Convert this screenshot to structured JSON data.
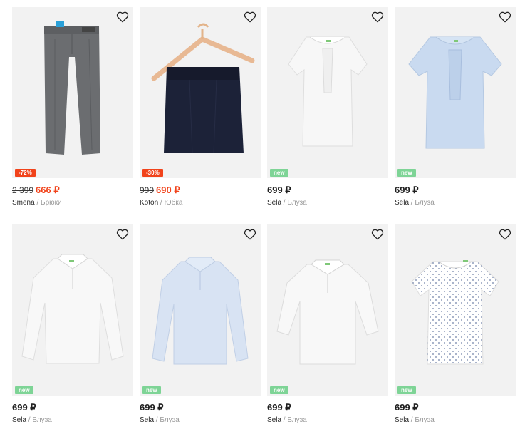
{
  "products": [
    {
      "id": "p1",
      "type": "pants",
      "badge": "-72%",
      "badge_kind": "sale",
      "old_price": "2 399",
      "price": "666 ₽",
      "brand": "Smena",
      "sep": " / ",
      "category": "Брюки"
    },
    {
      "id": "p2",
      "type": "skirt",
      "badge": "-30%",
      "badge_kind": "sale",
      "old_price": "999",
      "price": "690 ₽",
      "brand": "Koton",
      "sep": " / ",
      "category": "Юбка"
    },
    {
      "id": "p3",
      "type": "blouse-ruffle-white",
      "badge": "new",
      "badge_kind": "new",
      "old_price": "",
      "price": "699 ₽",
      "brand": "Sela",
      "sep": " / ",
      "category": "Блуза"
    },
    {
      "id": "p4",
      "type": "blouse-ruffle-blue",
      "badge": "new",
      "badge_kind": "new",
      "old_price": "",
      "price": "699 ₽",
      "brand": "Sela",
      "sep": " / ",
      "category": "Блуза"
    },
    {
      "id": "p5",
      "type": "longsleeve-white",
      "badge": "new",
      "badge_kind": "new",
      "old_price": "",
      "price": "699 ₽",
      "brand": "Sela",
      "sep": " / ",
      "category": "Блуза"
    },
    {
      "id": "p6",
      "type": "longsleeve-blue",
      "badge": "new",
      "badge_kind": "new",
      "old_price": "",
      "price": "699 ₽",
      "brand": "Sela",
      "sep": " / ",
      "category": "Блуза"
    },
    {
      "id": "p7",
      "type": "threequarter-white",
      "badge": "new",
      "badge_kind": "new",
      "old_price": "",
      "price": "699 ₽",
      "brand": "Sela",
      "sep": " / ",
      "category": "Блуза"
    },
    {
      "id": "p8",
      "type": "dotted-tee",
      "badge": "new",
      "badge_kind": "new",
      "old_price": "",
      "price": "699 ₽",
      "brand": "Sela",
      "sep": " / ",
      "category": "Блуза"
    }
  ],
  "icons": {
    "favorite": "heart-outline-icon"
  },
  "colors": {
    "sale": "#f1431b",
    "new": "#7ed496",
    "photo_bg": "#f2f2f2",
    "price": "#1f1f1f",
    "muted": "#9a9a9a"
  }
}
